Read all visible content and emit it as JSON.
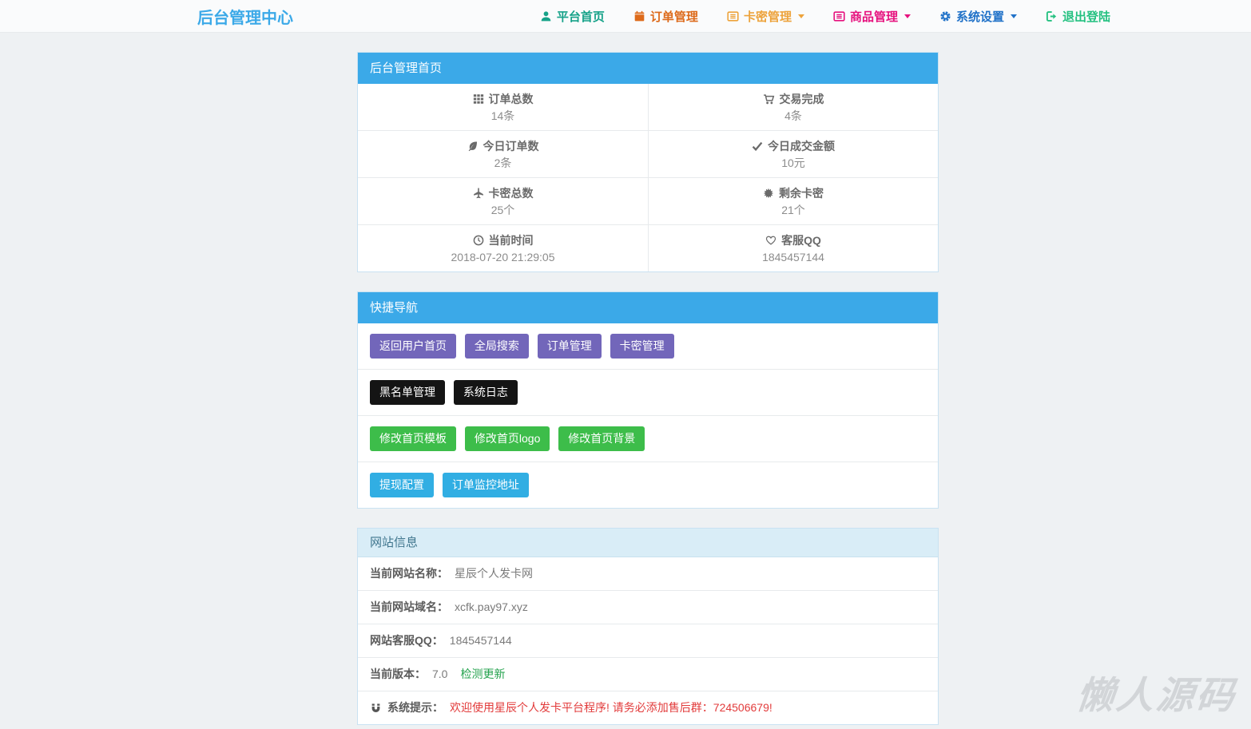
{
  "navbar": {
    "brand": "后台管理中心",
    "items": [
      {
        "label": "平台首页",
        "icon": "user-icon",
        "color": "#16a289",
        "dropdown": false
      },
      {
        "label": "订单管理",
        "icon": "calendar-icon",
        "color": "#dd6a1a",
        "dropdown": false
      },
      {
        "label": "卡密管理",
        "icon": "list-alt-icon",
        "color": "#eda33c",
        "dropdown": true
      },
      {
        "label": "商品管理",
        "icon": "list-alt-icon",
        "color": "#e6127e",
        "dropdown": true
      },
      {
        "label": "系统设置",
        "icon": "gear-icon",
        "color": "#2172c8",
        "dropdown": true
      },
      {
        "label": "退出登陆",
        "icon": "sign-out-icon",
        "color": "#25c181",
        "dropdown": false
      }
    ]
  },
  "dashboard": {
    "title": "后台管理首页",
    "stats": [
      {
        "label": "订单总数",
        "value": "14条",
        "icon": "th-icon"
      },
      {
        "label": "交易完成",
        "value": "4条",
        "icon": "cart-icon"
      },
      {
        "label": "今日订单数",
        "value": "2条",
        "icon": "leaf-icon"
      },
      {
        "label": "今日成交金额",
        "value": "10元",
        "icon": "check-icon"
      },
      {
        "label": "卡密总数",
        "value": "25个",
        "icon": "plane-icon"
      },
      {
        "label": "剩余卡密",
        "value": "21个",
        "icon": "certificate-icon"
      },
      {
        "label": "当前时间",
        "value": "2018-07-20 21:29:05",
        "icon": "clock-icon"
      },
      {
        "label": "客服QQ",
        "value": "1845457144",
        "icon": "heart-icon"
      }
    ]
  },
  "quick_nav": {
    "title": "快捷导航",
    "rows": [
      {
        "style": "purple",
        "color": "#7266ba",
        "buttons": [
          "返回用户首页",
          "全局搜索",
          "订单管理",
          "卡密管理"
        ]
      },
      {
        "style": "black",
        "color": "#141414",
        "buttons": [
          "黑名单管理",
          "系统日志"
        ]
      },
      {
        "style": "green",
        "color": "#3dbd4a",
        "buttons": [
          "修改首页模板",
          "修改首页logo",
          "修改首页背景"
        ]
      },
      {
        "style": "blue",
        "color": "#31aee3",
        "buttons": [
          "提现配置",
          "订单监控地址"
        ]
      }
    ]
  },
  "site_info": {
    "title": "网站信息",
    "rows": [
      {
        "label": "当前网站名称：",
        "value": "星辰个人发卡网"
      },
      {
        "label": "当前网站域名：",
        "value": "xcfk.pay97.xyz"
      },
      {
        "label": "网站客服QQ：",
        "value": "1845457144"
      },
      {
        "label": "当前版本：",
        "value": "7.0",
        "link": "检测更新"
      },
      {
        "label": "系统提示：",
        "value": "欢迎使用星辰个人发卡平台程序! 请务必添加售后群：724506679!",
        "icon": "magnet-icon"
      }
    ]
  },
  "watermark": "懒人源码",
  "colors": {
    "panel_header_blue": "#3ba9e8",
    "panel_header_light": "#d9edf7",
    "body_background": "#eef1f3",
    "navbar_background": "#fafbfc",
    "alert_red": "#e23b3b",
    "link_green": "#23a24d"
  }
}
